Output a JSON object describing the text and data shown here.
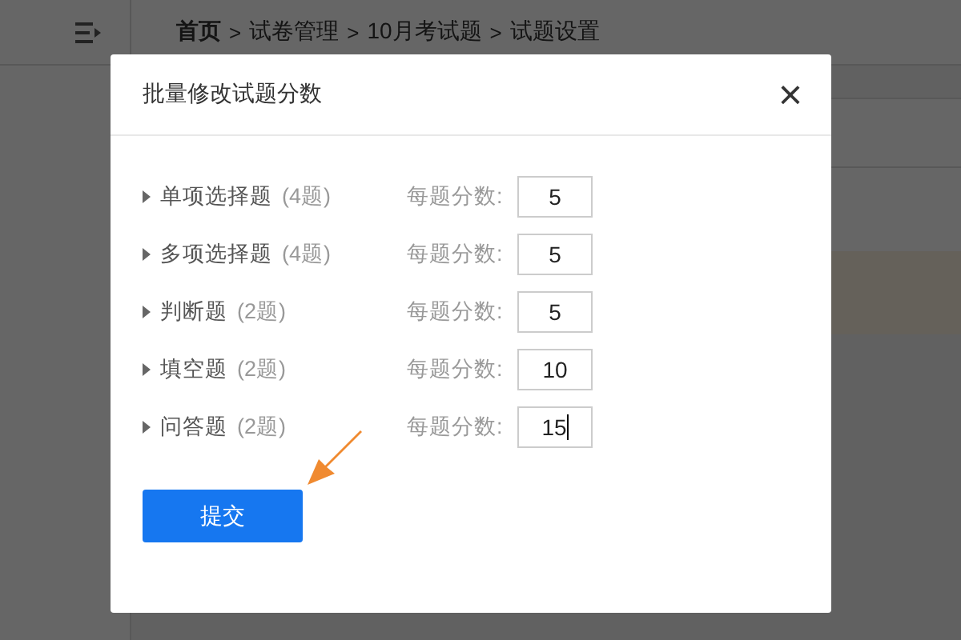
{
  "header": {
    "breadcrumb": [
      {
        "kind": "home",
        "text": "首页"
      },
      {
        "kind": "sep",
        "text": ">"
      },
      {
        "kind": "crumb",
        "text": "试卷管理"
      },
      {
        "kind": "sep",
        "text": ">"
      },
      {
        "kind": "crumb",
        "text": "10月考试题"
      },
      {
        "kind": "sep",
        "text": ">"
      },
      {
        "kind": "crumb",
        "text": "试题设置"
      }
    ]
  },
  "table": {
    "rows": [
      {
        "selected": false
      },
      {
        "selected": true
      }
    ]
  },
  "dialog": {
    "title": "批量修改试题分数",
    "close": "×",
    "rows": [
      {
        "name": "单项选择题",
        "count": "(4题)",
        "label": "每题分数:",
        "value": "5",
        "focused": false
      },
      {
        "name": "多项选择题",
        "count": "(4题)",
        "label": "每题分数:",
        "value": "5",
        "focused": false
      },
      {
        "name": "判断题",
        "count": "(2题)",
        "label": "每题分数:",
        "value": "5",
        "focused": false
      },
      {
        "name": "填空题",
        "count": "(2题)",
        "label": "每题分数:",
        "value": "10",
        "focused": false
      },
      {
        "name": "问答题",
        "count": "(2题)",
        "label": "每题分数:",
        "value": "15",
        "focused": true
      }
    ],
    "submit": "提交"
  }
}
